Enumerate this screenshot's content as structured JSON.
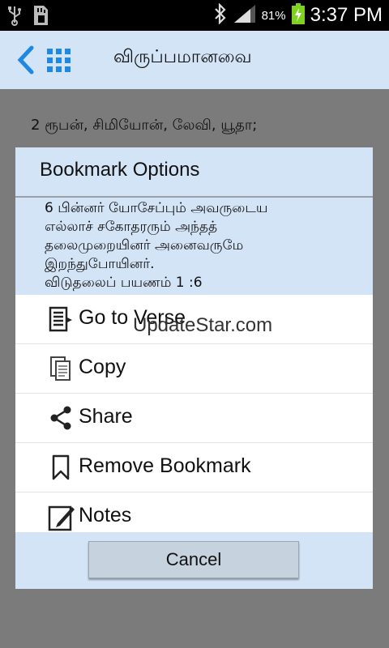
{
  "status_bar": {
    "battery_percent": "81%",
    "time": "3:37 PM",
    "icons": [
      "usb-icon",
      "sdcard-icon",
      "bluetooth-icon",
      "signal-icon",
      "battery-charging-icon"
    ]
  },
  "appbar": {
    "title": "விருப்பமானவை",
    "icons": [
      "back-icon",
      "grid-icon"
    ]
  },
  "content": {
    "verse_line": "2 ரூபன், சிமியோன், லேவி, யூதா;"
  },
  "dialog": {
    "title": "Bookmark Options",
    "verse_preview": [
      "6 பின்னர் யோசேப்பும் அவருடைய",
      "எல்லாச் சகோதரரும் அந்தத்",
      "தலைமுறையினர் அனைவருமே",
      "இறந்துபோயினர்.",
      "விடுதலைப் பயணம் 1 :6"
    ],
    "options": [
      {
        "label": "Go to Verse",
        "icon": "go-to-verse-icon"
      },
      {
        "label": "Copy",
        "icon": "copy-icon"
      },
      {
        "label": "Share",
        "icon": "share-icon"
      },
      {
        "label": "Remove Bookmark",
        "icon": "bookmark-icon"
      },
      {
        "label": "Notes",
        "icon": "notes-icon"
      }
    ],
    "watermark": "UpdateStar.com",
    "cancel_label": "Cancel"
  },
  "colors": {
    "accent": "#1e88e5",
    "appbar_bg": "#d4e4f7",
    "battery": "#7ed321"
  }
}
